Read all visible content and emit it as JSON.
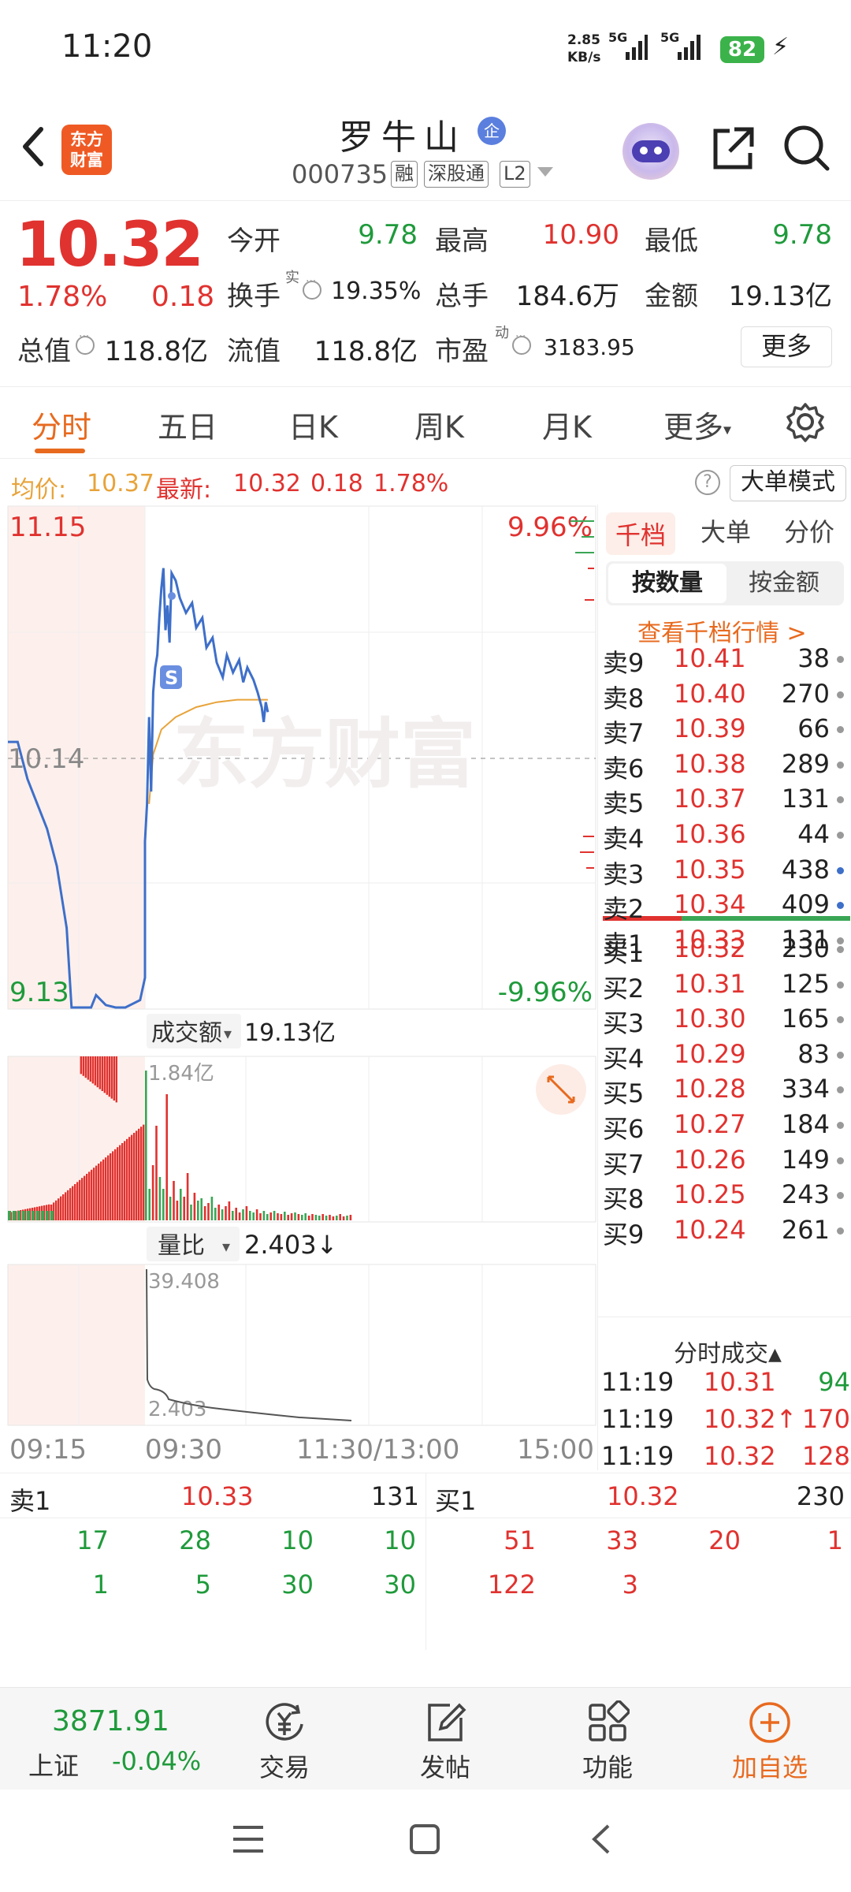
{
  "status_bar": {
    "time": "11:20",
    "net_speed_value": "2.85",
    "net_speed_unit": "KB/s",
    "signal1_label": "5G",
    "signal2_label": "5G",
    "battery": "82"
  },
  "header": {
    "logo_line1": "东方",
    "logo_line2": "财富",
    "stock_name": "罗牛山",
    "badge": "企",
    "stock_code": "000735",
    "tags": [
      "融",
      "深股通",
      "L2"
    ]
  },
  "quote": {
    "price": "10.32",
    "change_pct": "1.78%",
    "change": "0.18",
    "open_label": "今开",
    "open": "9.78",
    "high_label": "最高",
    "high": "10.90",
    "low_label": "最低",
    "low": "9.78",
    "turnover_label": "换手",
    "turnover_sup": "实",
    "turnover": "19.35%",
    "volume_label": "总手",
    "volume": "184.6万",
    "amount_label": "金额",
    "amount": "19.13亿",
    "mktcap_label": "总值",
    "mktcap": "118.8亿",
    "float_label": "流值",
    "float": "118.8亿",
    "pe_label": "市盈",
    "pe_sup": "动",
    "pe": "3183.95",
    "more": "更多"
  },
  "tabs": {
    "items": [
      "分时",
      "五日",
      "日K",
      "周K",
      "月K",
      "更多"
    ],
    "active": "分时"
  },
  "avg_row": {
    "avg_label": "均价:",
    "avg": "10.37",
    "latest_label": "最新:",
    "latest": "10.32",
    "change": "0.18",
    "change_pct": "1.78%",
    "big_order_mode": "大单模式",
    "help": "?"
  },
  "chart_data": {
    "type": "line",
    "price_axis": {
      "top": "11.15",
      "mid": "10.14",
      "bottom": "9.13",
      "top_pct": "9.96%",
      "bottom_pct": "-9.96%"
    },
    "time_axis": [
      "09:15",
      "09:30",
      "11:30/13:00",
      "15:00"
    ],
    "price_series": [
      [
        9.3,
        10.2
      ],
      [
        9.32,
        10.2
      ],
      [
        9.34,
        10.05
      ],
      [
        9.36,
        9.95
      ],
      [
        9.38,
        9.85
      ],
      [
        9.4,
        9.7
      ],
      [
        9.42,
        9.45
      ],
      [
        9.43,
        9.13
      ],
      [
        9.47,
        9.13
      ],
      [
        9.48,
        9.18
      ],
      [
        9.5,
        9.14
      ],
      [
        9.52,
        9.13
      ],
      [
        9.54,
        9.13
      ],
      [
        9.57,
        9.16
      ],
      [
        9.58,
        9.25
      ],
      [
        9.6,
        9.8
      ],
      [
        9.61,
        9.95
      ],
      [
        9.62,
        10.3
      ],
      [
        9.63,
        10.0
      ],
      [
        9.64,
        10.4
      ],
      [
        9.65,
        10.5
      ],
      [
        9.66,
        10.55
      ],
      [
        9.67,
        10.7
      ],
      [
        9.68,
        10.82
      ],
      [
        9.69,
        10.9
      ],
      [
        9.7,
        10.65
      ],
      [
        9.71,
        10.75
      ],
      [
        9.72,
        10.6
      ],
      [
        9.73,
        10.88
      ],
      [
        9.75,
        10.85
      ],
      [
        9.77,
        10.78
      ],
      [
        9.8,
        10.72
      ],
      [
        9.83,
        10.76
      ],
      [
        9.85,
        10.66
      ],
      [
        9.88,
        10.7
      ],
      [
        9.9,
        10.58
      ],
      [
        9.93,
        10.62
      ],
      [
        9.95,
        10.52
      ],
      [
        9.98,
        10.46
      ],
      [
        10.0,
        10.55
      ],
      [
        10.03,
        10.48
      ],
      [
        10.06,
        10.53
      ],
      [
        10.08,
        10.44
      ],
      [
        10.1,
        10.5
      ],
      [
        10.13,
        10.45
      ],
      [
        10.15,
        10.4
      ],
      [
        10.17,
        10.34
      ],
      [
        10.18,
        10.28
      ],
      [
        10.19,
        10.36
      ],
      [
        10.2,
        10.32
      ]
    ],
    "avg_series": [
      [
        9.62,
        9.95
      ],
      [
        9.64,
        10.15
      ],
      [
        9.68,
        10.25
      ],
      [
        9.75,
        10.3
      ],
      [
        9.85,
        10.34
      ],
      [
        9.95,
        10.36
      ],
      [
        10.05,
        10.37
      ],
      [
        10.15,
        10.37
      ],
      [
        10.2,
        10.37
      ]
    ],
    "turnover_title": "成交额",
    "turnover_total": "19.13亿",
    "turnover_axis_max": "1.84亿",
    "volume_ratio_title": "量比",
    "volume_ratio": "2.403↓",
    "volume_ratio_max": "39.408",
    "volume_ratio_min": "2.403",
    "watermark": "东方财富"
  },
  "order_book": {
    "tabs": [
      "千档",
      "大单",
      "分价"
    ],
    "segments": [
      "按数量",
      "按金额"
    ],
    "view_link": "查看千档行情 >",
    "asks": [
      {
        "label": "卖9",
        "price": "10.41",
        "vol": "38",
        "dot": "gray"
      },
      {
        "label": "卖8",
        "price": "10.40",
        "vol": "270",
        "dot": "gray"
      },
      {
        "label": "卖7",
        "price": "10.39",
        "vol": "66",
        "dot": "gray"
      },
      {
        "label": "卖6",
        "price": "10.38",
        "vol": "289",
        "dot": "gray"
      },
      {
        "label": "卖5",
        "price": "10.37",
        "vol": "131",
        "dot": "gray"
      },
      {
        "label": "卖4",
        "price": "10.36",
        "vol": "44",
        "dot": "gray"
      },
      {
        "label": "卖3",
        "price": "10.35",
        "vol": "438",
        "dot": "blue"
      },
      {
        "label": "卖2",
        "price": "10.34",
        "vol": "409",
        "dot": "blue"
      },
      {
        "label": "卖1",
        "price": "10.33",
        "vol": "131",
        "dot": "gray"
      }
    ],
    "bids": [
      {
        "label": "买1",
        "price": "10.32",
        "vol": "230",
        "dot": "gray"
      },
      {
        "label": "买2",
        "price": "10.31",
        "vol": "125",
        "dot": "gray"
      },
      {
        "label": "买3",
        "price": "10.30",
        "vol": "165",
        "dot": "gray"
      },
      {
        "label": "买4",
        "price": "10.29",
        "vol": "83",
        "dot": "gray"
      },
      {
        "label": "买5",
        "price": "10.28",
        "vol": "334",
        "dot": "gray"
      },
      {
        "label": "买6",
        "price": "10.27",
        "vol": "184",
        "dot": "gray"
      },
      {
        "label": "买7",
        "price": "10.26",
        "vol": "149",
        "dot": "gray"
      },
      {
        "label": "买8",
        "price": "10.25",
        "vol": "243",
        "dot": "gray"
      },
      {
        "label": "买9",
        "price": "10.24",
        "vol": "261",
        "dot": "gray"
      }
    ],
    "ticks_title": "分时成交",
    "ticks": [
      {
        "time": "11:19",
        "price": "10.31",
        "vol": "94",
        "vol_color": "green",
        "price_color": "red"
      },
      {
        "time": "11:19",
        "price": "10.32↑",
        "vol": "170",
        "vol_color": "red",
        "price_color": "red"
      },
      {
        "time": "11:19",
        "price": "10.32",
        "vol": "128",
        "vol_color": "red",
        "price_color": "red"
      }
    ]
  },
  "level_strip": {
    "sell_label": "卖1",
    "sell_price": "10.33",
    "sell_vol": "131",
    "buy_label": "买1",
    "buy_price": "10.32",
    "buy_vol": "230",
    "sell_queue_row1": [
      "17",
      "28",
      "10",
      "10"
    ],
    "sell_queue_row2": [
      "1",
      "5",
      "30",
      "30"
    ],
    "buy_queue_row1": [
      "51",
      "33",
      "20",
      "1"
    ],
    "buy_queue_row2": [
      "122",
      "3"
    ]
  },
  "bottom_nav": {
    "index_value": "3871.91",
    "index_name": "上证",
    "index_change": "-0.04%",
    "items": [
      "交易",
      "发帖",
      "功能",
      "加自选"
    ]
  },
  "colors": {
    "up": "#e0322f",
    "down": "#1f9a3b",
    "accent": "#e86a1f",
    "line": "#3e6fc9",
    "avg": "#e8a33a"
  }
}
